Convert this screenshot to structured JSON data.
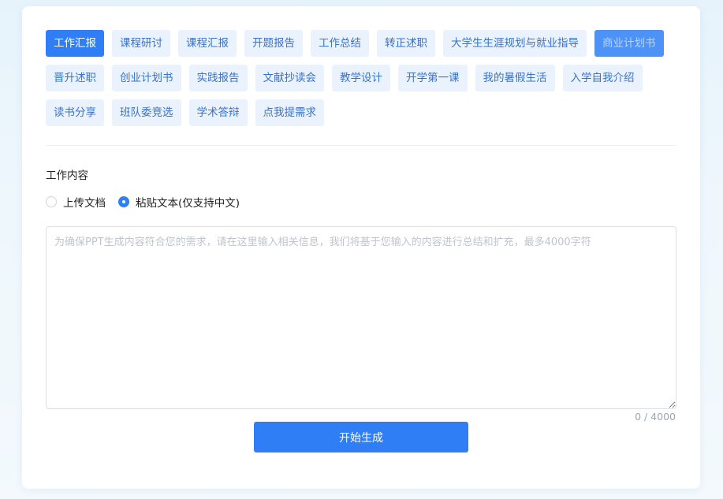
{
  "tags": [
    {
      "label": "工作汇报",
      "state": "active"
    },
    {
      "label": "课程研讨",
      "state": "normal"
    },
    {
      "label": "课程汇报",
      "state": "normal"
    },
    {
      "label": "开题报告",
      "state": "normal"
    },
    {
      "label": "工作总结",
      "state": "normal"
    },
    {
      "label": "转正述职",
      "state": "normal"
    },
    {
      "label": "大学生生涯规划与就业指导",
      "state": "normal"
    },
    {
      "label": "商业计划书",
      "state": "highlight"
    },
    {
      "label": "晋升述职",
      "state": "normal"
    },
    {
      "label": "创业计划书",
      "state": "normal"
    },
    {
      "label": "实践报告",
      "state": "normal"
    },
    {
      "label": "文献抄读会",
      "state": "normal"
    },
    {
      "label": "教学设计",
      "state": "normal"
    },
    {
      "label": "开学第一课",
      "state": "normal"
    },
    {
      "label": "我的暑假生活",
      "state": "normal"
    },
    {
      "label": "入学自我介绍",
      "state": "normal"
    },
    {
      "label": "读书分享",
      "state": "normal"
    },
    {
      "label": "班队委竞选",
      "state": "normal"
    },
    {
      "label": "学术答辩",
      "state": "normal"
    },
    {
      "label": "点我提需求",
      "state": "normal"
    }
  ],
  "content": {
    "label": "工作内容",
    "options": [
      {
        "label": "上传文档",
        "checked": false
      },
      {
        "label": "粘贴文本(仅支持中文)",
        "checked": true
      }
    ],
    "textarea_value": "",
    "textarea_placeholder": "为确保PPT生成内容符合您的需求，请在这里输入相关信息，我们将基于您输入的内容进行总结和扩充，最多4000字符",
    "counter": "0 / 4000"
  },
  "submit_label": "开始生成"
}
